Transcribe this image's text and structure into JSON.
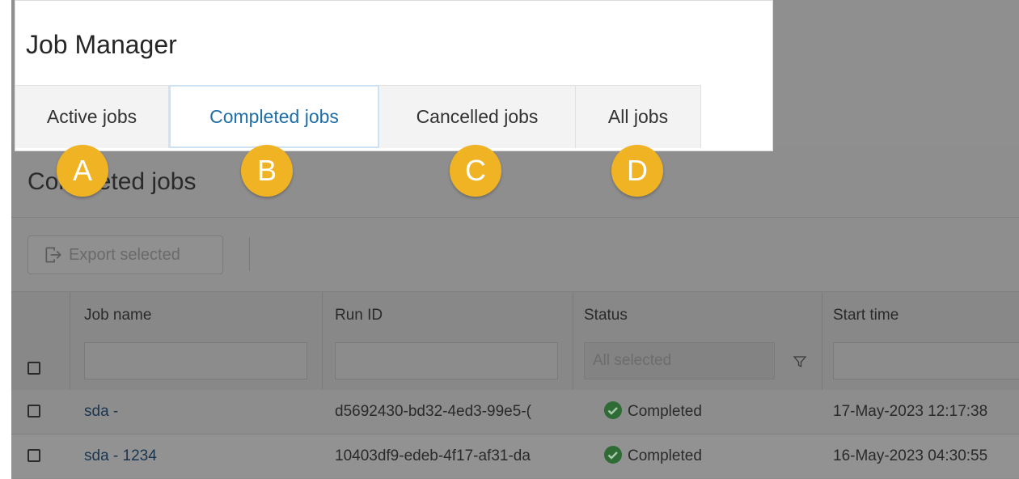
{
  "app": {
    "title": "Job Manager"
  },
  "tabs": [
    {
      "label": "Active jobs",
      "selected": false
    },
    {
      "label": "Completed jobs",
      "selected": true
    },
    {
      "label": "Cancelled jobs",
      "selected": false
    },
    {
      "label": "All jobs",
      "selected": false
    }
  ],
  "callouts": [
    "A",
    "B",
    "C",
    "D"
  ],
  "page": {
    "title": "Completed jobs"
  },
  "toolbar": {
    "export_label": "Export selected",
    "export_icon": "export-icon"
  },
  "table": {
    "columns": [
      "Job name",
      "Run ID",
      "Status",
      "Start time"
    ],
    "status_filter_value": "All selected",
    "rows": [
      {
        "job_name": "sda -",
        "run_id": "d5692430-bd32-4ed3-99e5-(",
        "status": "Completed",
        "start_time": "17-May-2023 12:17:38"
      },
      {
        "job_name": "sda - 1234",
        "run_id": "10403df9-edeb-4f17-af31-da",
        "status": "Completed",
        "start_time": "16-May-2023 04:30:55"
      }
    ]
  },
  "colors": {
    "accent": "#1f6ea6",
    "callout": "#f0b323",
    "success": "#2e7d32"
  }
}
